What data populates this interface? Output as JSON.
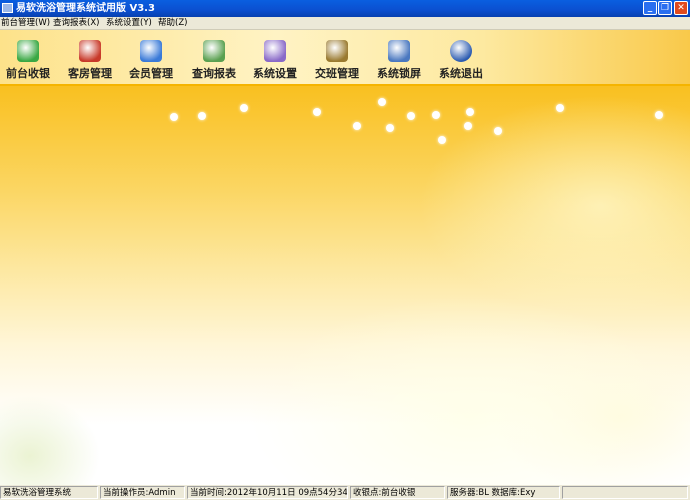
{
  "window": {
    "title": "易软洗浴管理系统试用版 V3.3",
    "minimize": "_",
    "restore": "❐",
    "close": "✕"
  },
  "menu": [
    {
      "label": "前台管理(W)"
    },
    {
      "label": "查询报表(X)"
    },
    {
      "label": "系统设置(Y)"
    },
    {
      "label": "帮助(Z)"
    }
  ],
  "toolbar": [
    {
      "label": "前台收银",
      "icon": "money-register-icon",
      "color": "#3aa844"
    },
    {
      "label": "客房管理",
      "icon": "house-icon",
      "color": "#c83a2a"
    },
    {
      "label": "会员管理",
      "icon": "members-icon",
      "color": "#3a7ad8"
    },
    {
      "label": "查询报表",
      "icon": "report-user-icon",
      "color": "#5aa050"
    },
    {
      "label": "系统设置",
      "icon": "settings-clipboard-icon",
      "color": "#8a6ac8"
    },
    {
      "label": "交班管理",
      "icon": "handshake-icon",
      "color": "#9a7a30"
    },
    {
      "label": "系统锁屏",
      "icon": "lock-user-icon",
      "color": "#4a78c0"
    },
    {
      "label": "系统退出",
      "icon": "power-icon",
      "color": "#2a5ab0"
    }
  ],
  "status": {
    "app": "易软洗浴管理系统",
    "operator": "当前操作员:Admin",
    "time": "当前时间:2012年10月11日 09点54分34秒",
    "cashier_point": "收银点:前台收银",
    "server": "服务器:BL  数据库:Exy",
    "extra": ""
  }
}
